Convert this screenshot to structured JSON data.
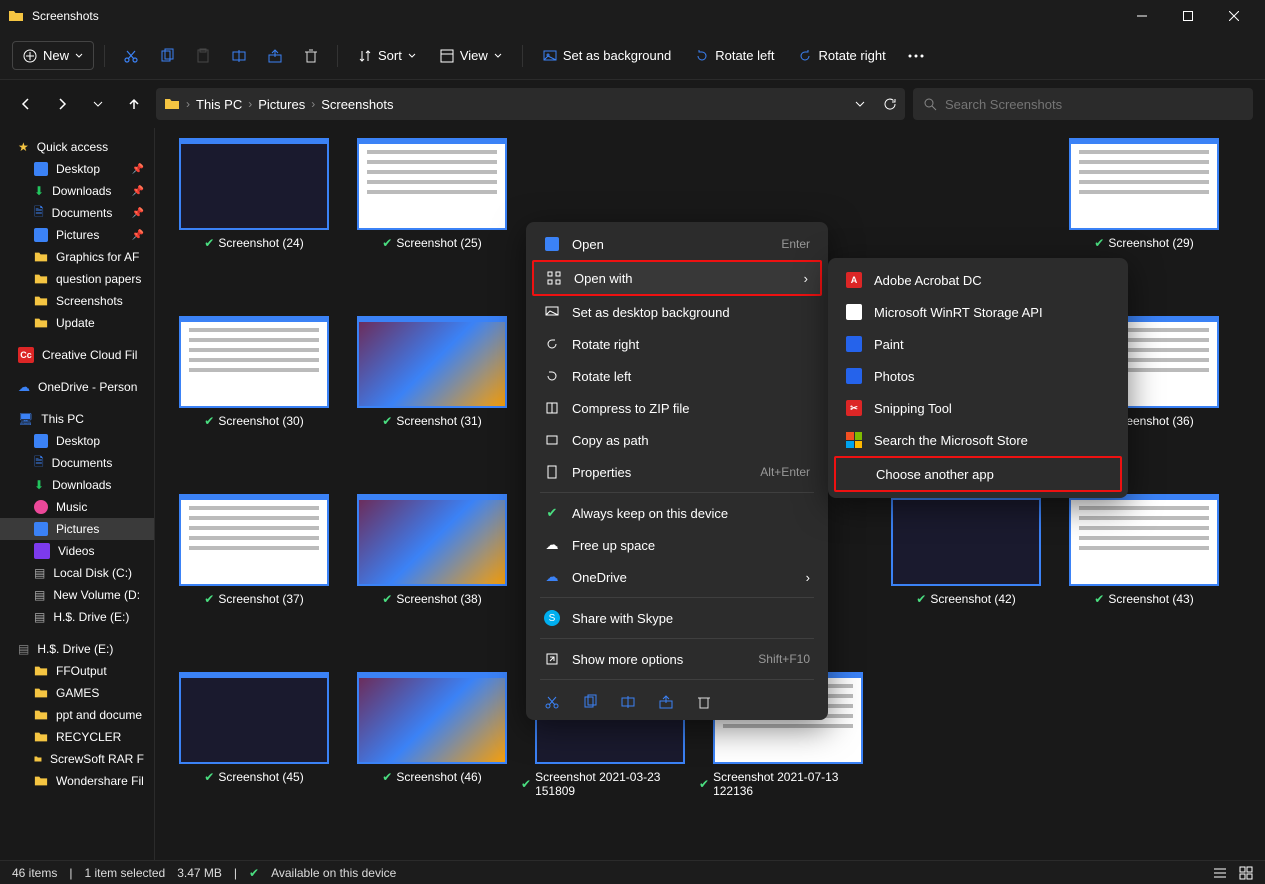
{
  "window": {
    "title": "Screenshots"
  },
  "toolbar": {
    "new": "New",
    "sort": "Sort",
    "view": "View",
    "set_bg": "Set as background",
    "rotate_left": "Rotate left",
    "rotate_right": "Rotate right"
  },
  "breadcrumb": [
    "This PC",
    "Pictures",
    "Screenshots"
  ],
  "search": {
    "placeholder": "Search Screenshots"
  },
  "sidebar": {
    "quick": "Quick access",
    "qitems": [
      {
        "label": "Desktop",
        "pin": true,
        "icon": "desktop"
      },
      {
        "label": "Downloads",
        "pin": true,
        "icon": "download"
      },
      {
        "label": "Documents",
        "pin": true,
        "icon": "doc"
      },
      {
        "label": "Pictures",
        "pin": true,
        "icon": "pic"
      },
      {
        "label": "Graphics for AF",
        "icon": "folder"
      },
      {
        "label": "question papers",
        "icon": "folder"
      },
      {
        "label": "Screenshots",
        "icon": "folder"
      },
      {
        "label": "Update",
        "icon": "folder"
      }
    ],
    "cc": "Creative Cloud Fil",
    "od": "OneDrive - Person",
    "pc": "This PC",
    "pcitems": [
      {
        "label": "Desktop",
        "icon": "desktop"
      },
      {
        "label": "Documents",
        "icon": "doc"
      },
      {
        "label": "Downloads",
        "icon": "download"
      },
      {
        "label": "Music",
        "icon": "music"
      },
      {
        "label": "Pictures",
        "icon": "pic",
        "selected": true
      },
      {
        "label": "Videos",
        "icon": "video"
      },
      {
        "label": "Local Disk (C:)",
        "icon": "drive"
      },
      {
        "label": "New Volume (D:",
        "icon": "drive"
      },
      {
        "label": "H.$. Drive (E:)",
        "icon": "drive"
      }
    ],
    "hs": "H.$. Drive (E:)",
    "hsitems": [
      {
        "label": "FFOutput"
      },
      {
        "label": "GAMES"
      },
      {
        "label": "ppt and docume"
      },
      {
        "label": "RECYCLER"
      },
      {
        "label": "ScrewSoft RAR F"
      },
      {
        "label": "Wondershare Fil"
      }
    ]
  },
  "files": [
    {
      "name": "Screenshot (24)",
      "style": "dark"
    },
    {
      "name": "Screenshot (25)",
      "style": "doc"
    },
    {
      "name": "Screenshot (29)",
      "style": "doc"
    },
    {
      "name": "Screenshot (30)",
      "style": "doc"
    },
    {
      "name": "Screenshot (31)",
      "style": "colorful"
    },
    {
      "name": "Screenshot (36)",
      "style": "doc"
    },
    {
      "name": "Screenshot (37)",
      "style": "doc"
    },
    {
      "name": "Screenshot (38)",
      "style": "colorful"
    },
    {
      "name": "Screenshot (42)",
      "style": "dark"
    },
    {
      "name": "Screenshot (43)",
      "style": "doc"
    },
    {
      "name": "Screenshot (45)",
      "style": "dark"
    },
    {
      "name": "Screenshot (46)",
      "style": "colorful"
    },
    {
      "name": "Screenshot 2021-03-23 151809",
      "style": "dark"
    },
    {
      "name": "Screenshot 2021-07-13 122136",
      "style": "doc"
    }
  ],
  "context": {
    "open": "Open",
    "open_accel": "Enter",
    "open_with": "Open with",
    "set_desktop": "Set as desktop background",
    "rotate_right": "Rotate right",
    "rotate_left": "Rotate left",
    "compress": "Compress to ZIP file",
    "copy_path": "Copy as path",
    "properties": "Properties",
    "properties_accel": "Alt+Enter",
    "always_keep": "Always keep on this device",
    "free_up": "Free up space",
    "onedrive": "OneDrive",
    "skype": "Share with Skype",
    "show_more": "Show more options",
    "show_more_accel": "Shift+F10"
  },
  "submenu": {
    "items": [
      {
        "label": "Adobe Acrobat DC",
        "icon": "acrobat"
      },
      {
        "label": "Microsoft WinRT Storage API",
        "icon": "blank"
      },
      {
        "label": "Paint",
        "icon": "paint"
      },
      {
        "label": "Photos",
        "icon": "photos"
      },
      {
        "label": "Snipping Tool",
        "icon": "snip"
      },
      {
        "label": "Search the Microsoft Store",
        "icon": "msstore"
      },
      {
        "label": "Choose another app",
        "icon": "none"
      }
    ]
  },
  "statusbar": {
    "count": "46 items",
    "selected": "1 item selected",
    "size": "3.47 MB",
    "avail": "Available on this device"
  }
}
